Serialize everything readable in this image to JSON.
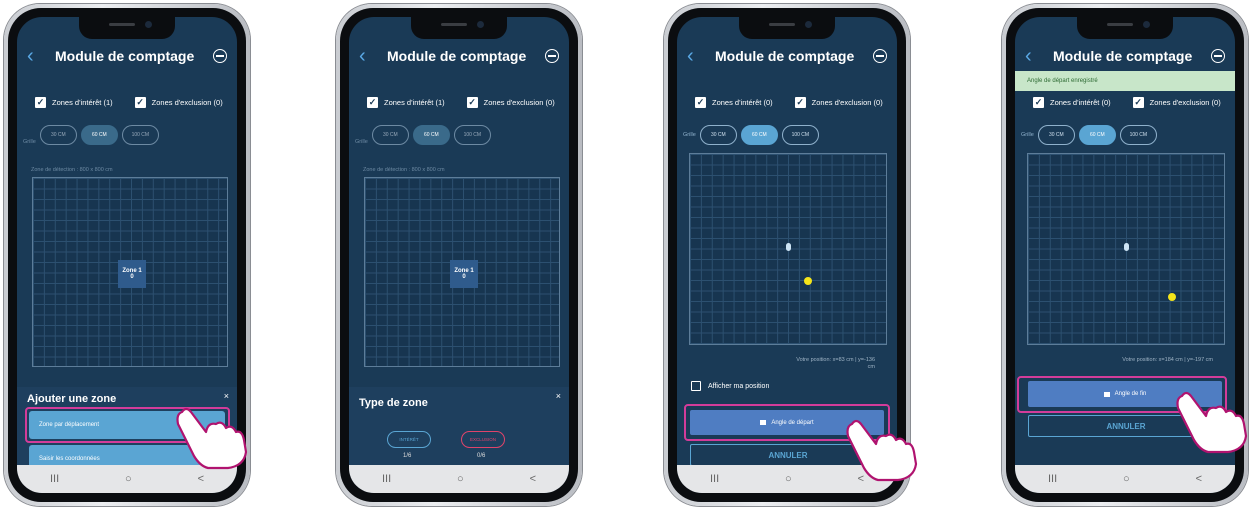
{
  "common": {
    "title": "Module de comptage",
    "grid_label": "Grille",
    "grid_options": [
      "30 CM",
      "60 CM",
      "100 CM"
    ],
    "grid_selected": "60 CM",
    "detection_label": "Zone de détection : 800 x 800 cm"
  },
  "screen1": {
    "interest_label": "Zones d'intérêt (1)",
    "exclusion_label": "Zones d'exclusion (0)",
    "zone_name": "Zone 1",
    "zone_index": "0",
    "sheet_title": "Ajouter une zone",
    "close_glyph": "×",
    "option_move": "Zone par déplacement",
    "option_coords": "Saisir les coordonnées"
  },
  "screen2": {
    "interest_label": "Zones d'intérêt (1)",
    "exclusion_label": "Zones d'exclusion (0)",
    "zone_name": "Zone 1",
    "zone_index": "0",
    "sheet_title": "Type de zone",
    "close_glyph": "×",
    "interest_btn": "INTÉRÊT",
    "interest_count": "1/6",
    "exclusion_btn": "EXCLUSION",
    "exclusion_count": "0/6"
  },
  "screen3": {
    "interest_label": "Zones d'intérêt (0)",
    "exclusion_label": "Zones d'exclusion (0)",
    "position_line1": "Votre position: x=83 cm | y=-136",
    "position_line2": "cm",
    "show_position": "Afficher ma position",
    "start_angle_btn": "Angle de départ",
    "cancel_btn": "ANNULER"
  },
  "screen4": {
    "toast": "Angle de départ enregistré",
    "interest_label": "Zones d'intérêt (0)",
    "exclusion_label": "Zones d'exclusion (0)",
    "position_line1": "Votre position: x=184 cm | y=-197 cm",
    "end_angle_btn": "Angle de fin",
    "cancel_btn": "ANNULER"
  },
  "nav": {
    "recent": "III",
    "home": "○",
    "back": "<"
  },
  "colors": {
    "screen_bg": "#1a3a56",
    "highlight": "#d33c9a",
    "accent": "#5aa5d3",
    "primary_btn": "#4f7dc2",
    "user_dot": "#f5e51a"
  }
}
